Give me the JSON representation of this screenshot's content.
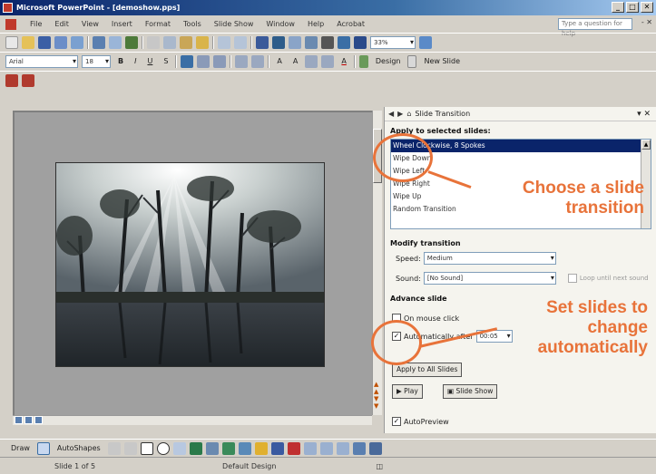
{
  "window": {
    "title": "Microsoft PowerPoint - [demoshow.pps]"
  },
  "menu": {
    "items": [
      "File",
      "Edit",
      "View",
      "Insert",
      "Format",
      "Tools",
      "Slide Show",
      "Window",
      "Help",
      "Acrobat"
    ],
    "ask_placeholder": "Type a question for help",
    "close_glyph": "- ✕"
  },
  "toolbar": {
    "zoom": "33%",
    "font": "Arial",
    "font_size": "18",
    "bold": "B",
    "italic": "I",
    "underline": "U",
    "shadow": "S",
    "design_label": "Design",
    "new_slide_label": "New Slide"
  },
  "task_pane": {
    "title": "Slide Transition",
    "apply_heading": "Apply to selected slides:",
    "transitions": [
      "Wheel Clockwise, 8 Spokes",
      "Wipe Down",
      "Wipe Left",
      "Wipe Right",
      "Wipe Up",
      "Random Transition"
    ],
    "selected_index": 0,
    "modify_heading": "Modify transition",
    "speed_label": "Speed:",
    "speed_value": "Medium",
    "sound_label": "Sound:",
    "sound_value": "[No Sound]",
    "loop_label": "Loop until next sound",
    "advance_heading": "Advance slide",
    "on_mouse_click_label": "On mouse click",
    "auto_label": "Automatically after",
    "auto_value": "00:05",
    "apply_all_label": "Apply to All Slides",
    "play_label": "Play",
    "slideshow_label": "Slide Show",
    "autopreview_label": "AutoPreview"
  },
  "callouts": {
    "transition": [
      "Choose a slide",
      "transition"
    ],
    "auto": [
      "Set slides to",
      "change",
      "automatically"
    ]
  },
  "drawing": {
    "draw_label": "Draw",
    "autoshapes_label": "AutoShapes"
  },
  "status": {
    "slide": "Slide 1 of 5",
    "design": "Default Design"
  },
  "colors": {
    "callout": "#e8733a",
    "selection": "#0a246a"
  }
}
